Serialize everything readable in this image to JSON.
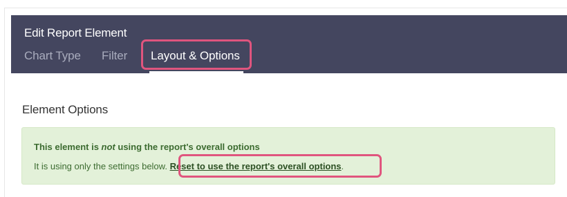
{
  "dialog": {
    "title": "Edit Report Element"
  },
  "tabs": [
    {
      "label": "Chart Type",
      "active": false
    },
    {
      "label": "Filter",
      "active": false
    },
    {
      "label": "Layout & Options",
      "active": true
    }
  ],
  "section": {
    "title": "Element Options"
  },
  "alert": {
    "line1_prefix": "This element is ",
    "line1_emphasis": "not",
    "line1_suffix": " using the report's overall options",
    "line2_prefix": "It is using only the settings below. ",
    "link_label": "Reset to use the report's overall options",
    "line2_suffix": "."
  },
  "colors": {
    "header_bg": "#44465f",
    "highlight": "#e0557e",
    "alert_bg": "#e3f1d9",
    "alert_text": "#3c6b30"
  }
}
